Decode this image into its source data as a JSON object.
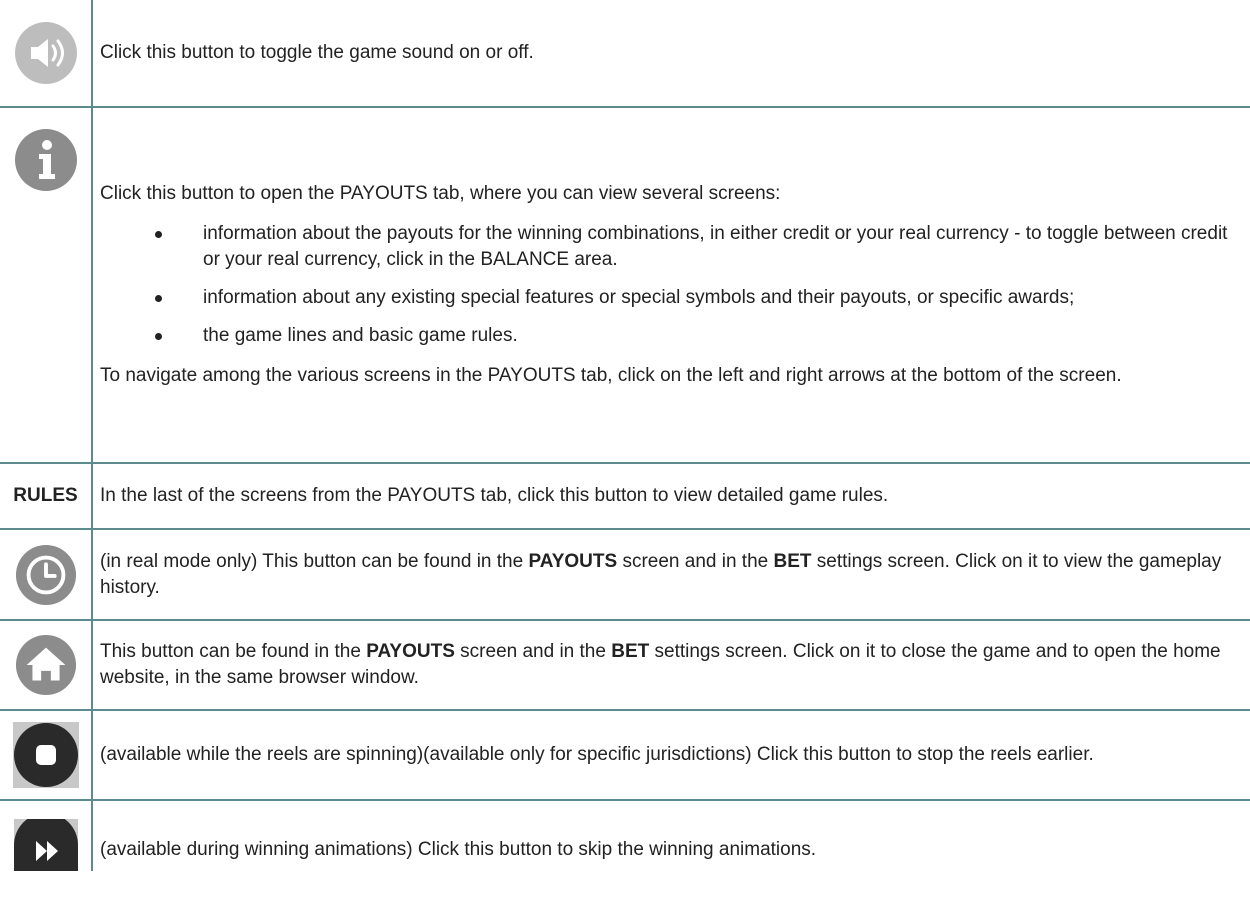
{
  "rows": [
    {
      "icon": "speaker-icon",
      "text": "Click this button to toggle the game sound on or off."
    },
    {
      "icon": "info-icon",
      "intro": "Click this button to open the PAYOUTS tab, where you can view several screens:",
      "bullets": [
        "information about the payouts for the winning combinations, in either credit or your real currency - to toggle between credit or your real currency, click in the BALANCE area.",
        "information about any existing special features or special symbols and their payouts, or specific awards;",
        "the game lines and basic game rules."
      ],
      "outro": "To navigate among the various screens in the PAYOUTS tab, click on the left and right arrows at the bottom of the screen."
    },
    {
      "label": "RULES",
      "text": "In the last of the screens from the PAYOUTS tab, click this button to view detailed game rules."
    },
    {
      "icon": "clock-icon",
      "pre": "(in real mode only) This button can be found in the ",
      "b1": "PAYOUTS",
      "mid": " screen and in the ",
      "b2": "BET",
      "post": " settings screen. Click on it to view the gameplay history."
    },
    {
      "icon": "home-icon",
      "pre": "This button can be found in the ",
      "b1": "PAYOUTS",
      "mid": " screen and in the ",
      "b2": "BET",
      "post": " settings screen. Click on it to close the game and to open the home website, in the same browser window."
    },
    {
      "icon": "stop-icon",
      "text": "(available while the reels are spinning)(available only for specific jurisdictions) Click this button to stop the reels earlier."
    },
    {
      "icon": "fast-forward-icon",
      "text": "(available during winning animations) Click this button to skip the winning animations."
    }
  ],
  "colors": {
    "border": "#5d8a8f",
    "icon_gray": "#8c8c8c",
    "icon_light": "#bdbdbd",
    "icon_dark": "#2a2a2a"
  }
}
